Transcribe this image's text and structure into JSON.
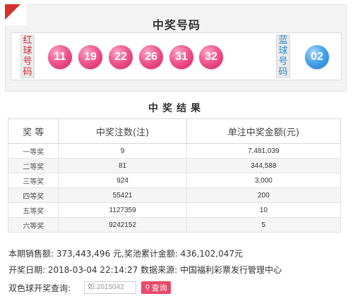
{
  "header": {
    "title": "中奖号码"
  },
  "red_label": [
    "红",
    "球",
    "号",
    "码"
  ],
  "blue_label": [
    "蓝",
    "球",
    "号",
    "码"
  ],
  "red_balls": [
    "11",
    "19",
    "22",
    "26",
    "31",
    "32"
  ],
  "blue_ball": "02",
  "prize_section": {
    "title": "中奖结果",
    "columns": [
      "奖 等",
      "中奖注数(注)",
      "单注中奖金额(元)"
    ],
    "rows": [
      {
        "level": "一等奖",
        "count": "9",
        "amount": "7,481,039"
      },
      {
        "level": "二等奖",
        "count": "81",
        "amount": "344,588"
      },
      {
        "level": "三等奖",
        "count": "924",
        "amount": "3,000"
      },
      {
        "level": "四等奖",
        "count": "55421",
        "amount": "200"
      },
      {
        "level": "五等奖",
        "count": "1127359",
        "amount": "10"
      },
      {
        "level": "六等奖",
        "count": "9242152",
        "amount": "5"
      }
    ]
  },
  "footer": {
    "sales_line": "本期销售额: 373,443,496 元,奖池累计金额: 436,102,047元",
    "draw_line": "开奖日期: 2018-03-04 22:14:27 数据来源: 中国福利彩票发行管理中心",
    "query_label": "双色球开奖查询:",
    "query_placeholder": "如:2015042",
    "query_button": "查询",
    "query_icon": "search-icon"
  },
  "colors": {
    "accent_red": "#d3322a",
    "ball_red": "#e8417d",
    "ball_blue": "#2a8ad4",
    "button": "#e84a6a"
  }
}
